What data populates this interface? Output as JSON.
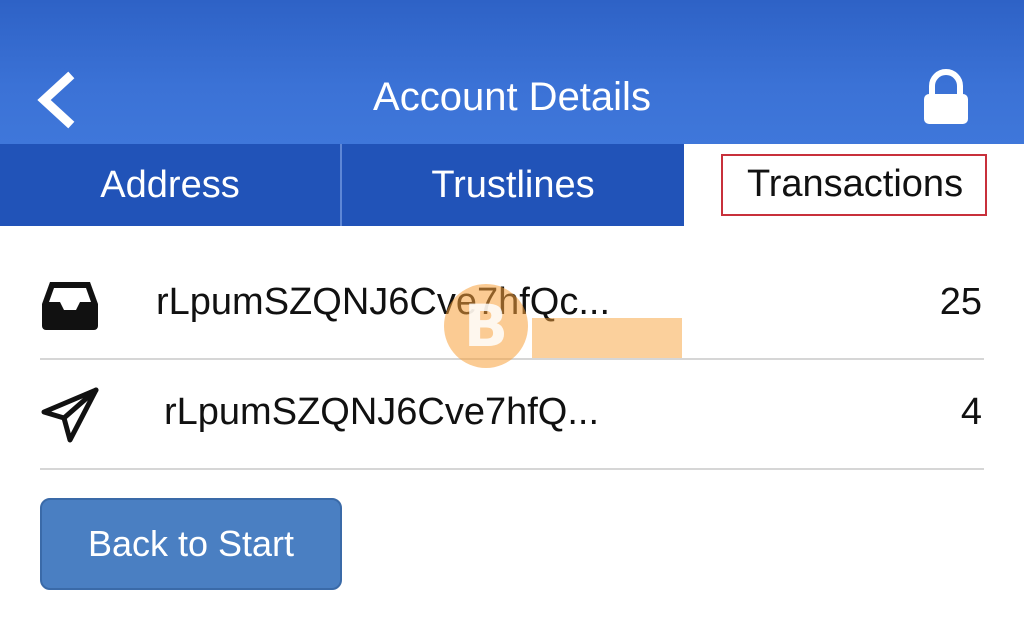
{
  "header": {
    "title": "Account Details",
    "back_icon": "chevron-left-icon",
    "lock_icon": "lock-icon",
    "background": "#3b72d6"
  },
  "tabs": [
    {
      "label": "Address",
      "active": false
    },
    {
      "label": "Trustlines",
      "active": false
    },
    {
      "label": "Transactions",
      "active": true
    }
  ],
  "transactions": [
    {
      "icon": "inbox-icon",
      "address": "rLpumSZQNJ6Cve7hfQc...",
      "count": "25"
    },
    {
      "icon": "send-icon",
      "address": "rLpumSZQNJ6Cve7hfQ...",
      "count": "4"
    }
  ],
  "actions": {
    "back_to_start": "Back to Start"
  },
  "colors": {
    "tab_inactive": "#2153b8",
    "highlight_border": "#c8303b",
    "button": "#4a7fc2"
  }
}
